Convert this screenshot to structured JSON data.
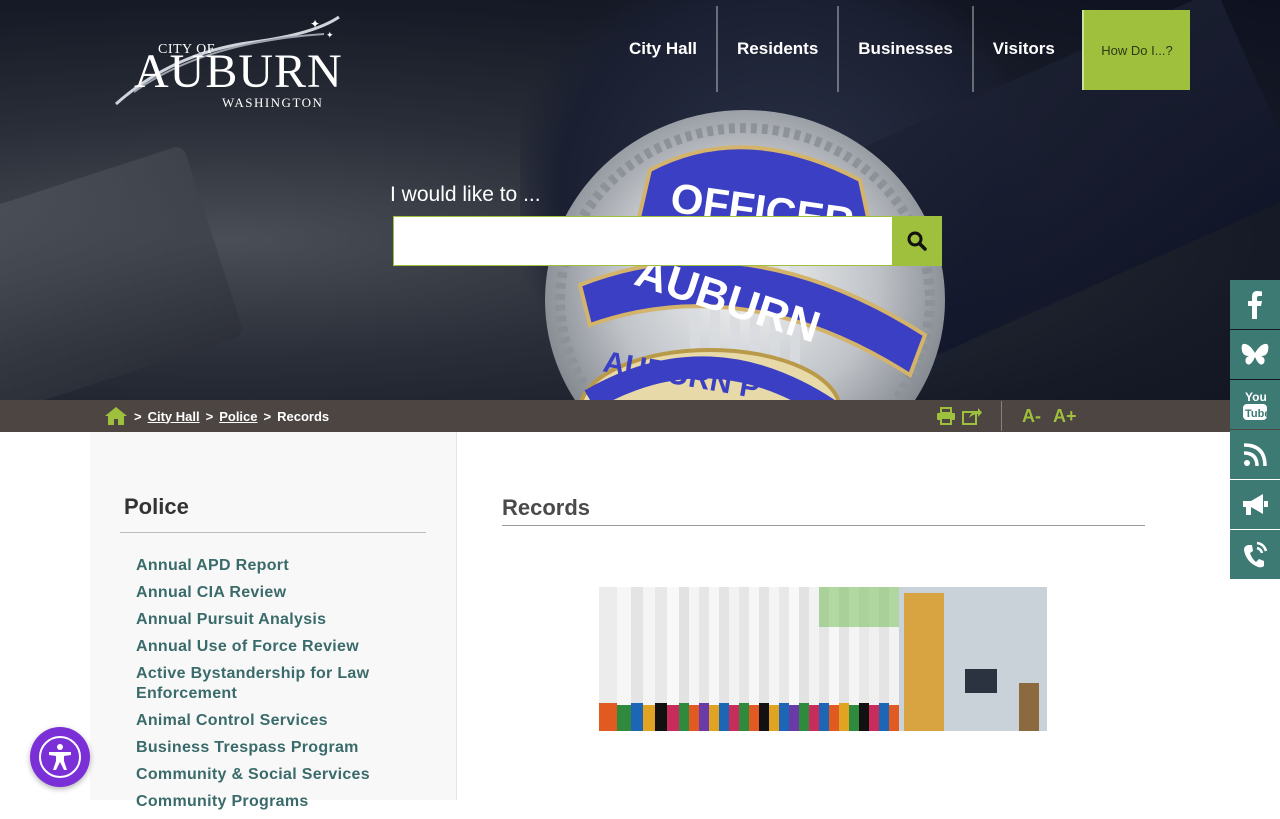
{
  "logo": {
    "city_of": "CITY OF",
    "name": "AUBURN",
    "state": "WASHINGTON"
  },
  "nav": {
    "items": [
      "City Hall",
      "Residents",
      "Businesses",
      "Visitors"
    ],
    "how_do_i": "How Do I...?"
  },
  "search": {
    "label": "I would like to ...",
    "placeholder": ""
  },
  "breadcrumb": {
    "home_icon": "home-icon",
    "items": [
      "City Hall",
      "Police"
    ],
    "current": "Records",
    "separator": ">"
  },
  "tools": {
    "print_icon": "print-icon",
    "share_icon": "share-icon",
    "decrease": "A-",
    "increase": "A+"
  },
  "sidebar": {
    "title": "Police",
    "items": [
      "Annual APD Report",
      "Annual CIA Review",
      "Annual Pursuit Analysis",
      "Annual Use of Force Review",
      "Active Bystandership for Law Enforcement",
      "Animal Control Services",
      "Business Trespass Program",
      "Community & Social Services",
      "Community Programs"
    ]
  },
  "main": {
    "title": "Records"
  },
  "social": [
    "facebook-icon",
    "bluesky-icon",
    "youtube-icon",
    "rss-icon",
    "megaphone-icon",
    "phone-icon"
  ],
  "colors": {
    "accent_green": "#9ec03c",
    "teal": "#3d7a73",
    "link_teal": "#3a6b6a",
    "bar_brown": "#4c4542",
    "a11y_purple": "#7b2fd6"
  }
}
